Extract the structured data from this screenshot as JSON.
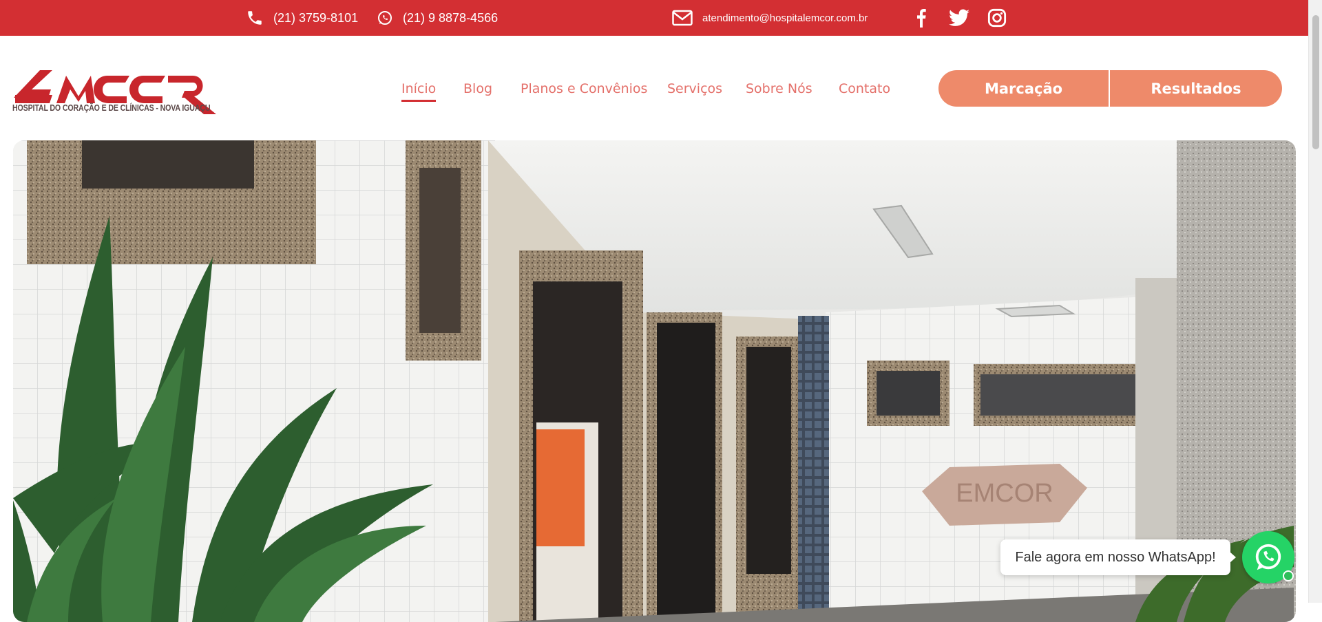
{
  "topbar": {
    "phone": "(21) 3759-8101",
    "whatsapp": "(21) 9 8878-4566",
    "email": "atendimento@hospitalemcor.com.br",
    "social": [
      "facebook-icon",
      "twitter-icon",
      "instagram-icon"
    ]
  },
  "brand": {
    "logo_text": "EMCOR",
    "subtitle": "HOSPITAL DO CORAÇÃO E DE CLÍNICAS - NOVA IGUAÇU"
  },
  "nav": {
    "items": [
      {
        "label": "Início",
        "active": true
      },
      {
        "label": "Blog"
      },
      {
        "label": "Planos e Convênios"
      },
      {
        "label": "Serviços"
      },
      {
        "label": "Sobre Nós"
      },
      {
        "label": "Contato"
      }
    ]
  },
  "actions": {
    "schedule": "Marcação",
    "results": "Resultados"
  },
  "hero": {
    "sign_text": "EMCOR"
  },
  "whatsapp_widget": {
    "message": "Fale agora em nosso WhatsApp!"
  },
  "colors": {
    "brand_red": "#d32f33",
    "button_salmon": "#ee8a6a",
    "nav_text": "#e4706a",
    "whatsapp_green": "#25d366"
  }
}
